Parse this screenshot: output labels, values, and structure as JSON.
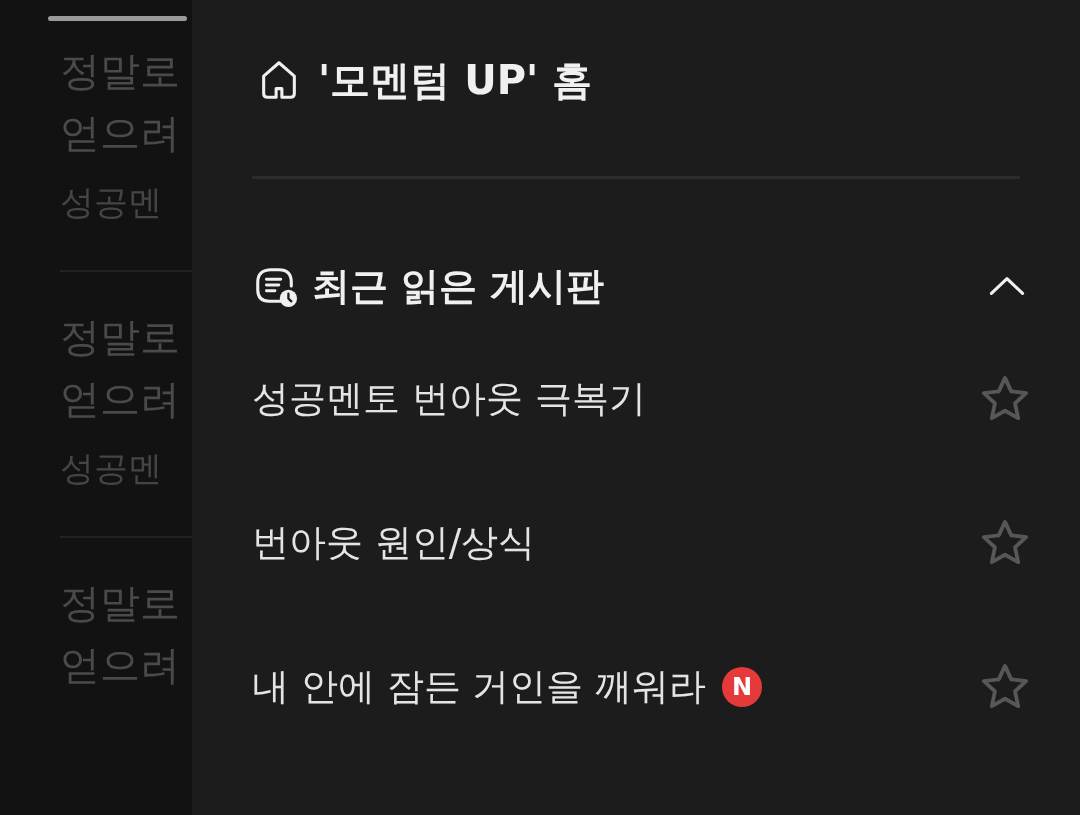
{
  "background_posts": [
    {
      "title": "정말로",
      "subtitle": "얻으려",
      "board": "성공멘"
    },
    {
      "title": "정말로",
      "subtitle": "얻으려",
      "board": "성공멘"
    },
    {
      "title": "정말로",
      "subtitle": "얻으려"
    }
  ],
  "drawer": {
    "home_link": "'모멘텀 UP' 홈",
    "recent_section": {
      "title": "최근 읽은 게시판",
      "expanded": true,
      "boards": [
        {
          "name": "성공멘토 번아웃 극복기",
          "favorite": false
        },
        {
          "name": "번아웃 원인/상식",
          "favorite": false
        },
        {
          "name": "내 안에 잠든 거인을 깨워라",
          "badge": "N",
          "favorite": false
        }
      ]
    }
  }
}
